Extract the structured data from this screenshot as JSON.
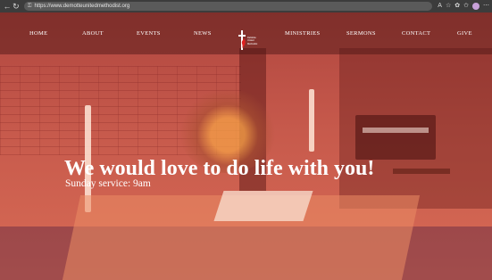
{
  "browser": {
    "back_icon": "arrow-left-icon",
    "refresh_icon": "refresh-icon",
    "url": "https://www.demotteunitedmethodist.org",
    "toolbar_icons": [
      "read-aloud-icon",
      "favorite-star-icon",
      "extensions-icon",
      "favorites-icon",
      "profile-icon",
      "more-icon"
    ]
  },
  "nav": {
    "items": [
      {
        "label": "HOME"
      },
      {
        "label": "ABOUT"
      },
      {
        "label": "EVENTS"
      },
      {
        "label": "NEWS"
      },
      {
        "label": "MINISTRIES"
      },
      {
        "label": "SERMONS"
      },
      {
        "label": "CONTACT"
      },
      {
        "label": "GIVE"
      }
    ],
    "logo": {
      "icon": "cross-and-flame-icon",
      "text": "DeMotte United Methodist"
    }
  },
  "hero": {
    "headline": "We would love to do life with you!",
    "subline": "Sunday service: 9am",
    "overlay_color": "#c7574a"
  }
}
